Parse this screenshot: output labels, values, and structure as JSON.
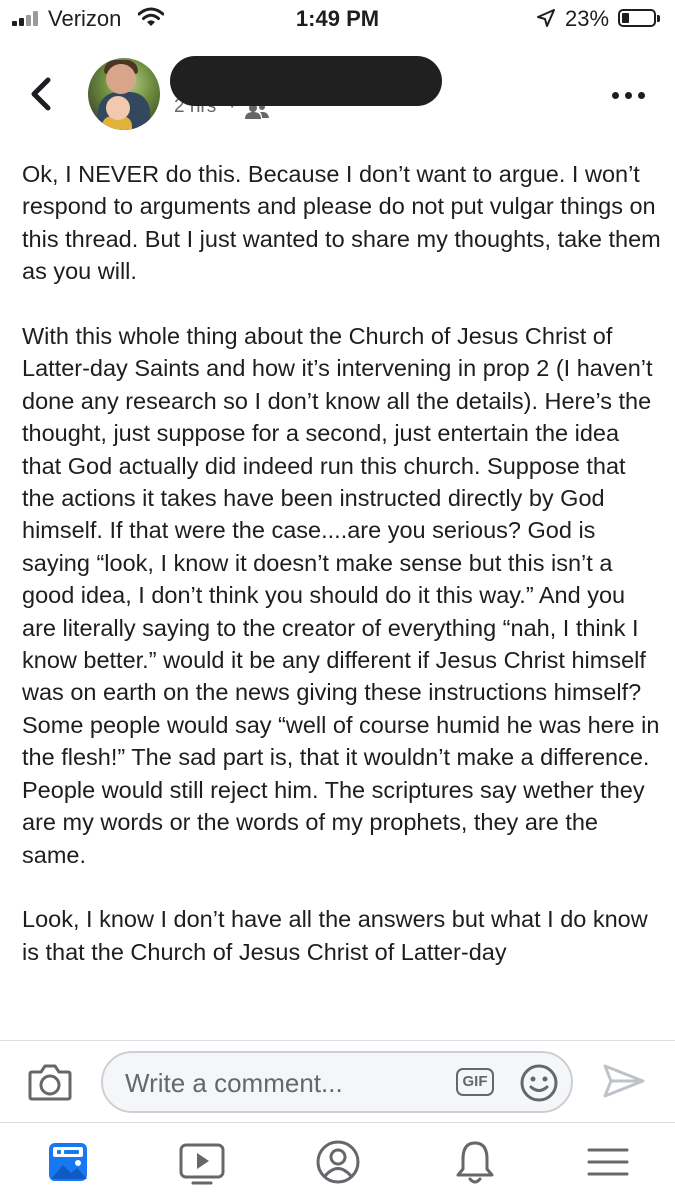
{
  "status_bar": {
    "carrier": "Verizon",
    "time": "1:49 PM",
    "battery_percent": "23%",
    "battery_level": 0.23
  },
  "post": {
    "time": "2 hrs",
    "separator": "·",
    "audience_icon": "friends-icon",
    "paragraphs": [
      "Ok, I NEVER do this. Because I don’t want to argue. I won’t respond to arguments and please do not put vulgar things on this thread. But I just wanted to share my thoughts, take them as you will.",
      "With this whole thing about the Church of Jesus Christ of Latter-day Saints and how it’s intervening in prop 2 (I haven’t done any research so I don’t know all the details). Here’s the thought, just suppose for a second, just entertain the idea that God actually did indeed run this church. Suppose that the actions it takes have been instructed directly by God himself. If that were the case....are you serious? God is saying “look, I know it doesn’t make sense but this isn’t a good idea, I don’t think you should do it this way.” And you are literally saying to the creator of everything “nah, I think I know better.” would it be any different if Jesus Christ himself was on earth on the news giving these instructions himself? Some people would say “well of course humid he was here in the flesh!” The sad part is, that it wouldn’t make a difference. People would still reject him. The scriptures say wether they are my words or the words of my prophets, they are the same.",
      "Look, I know I don’t have all the answers but what I do know is that the Church of Jesus Christ of Latter-day"
    ]
  },
  "comment_bar": {
    "placeholder": "Write a comment...",
    "gif_label": "GIF"
  },
  "tab_bar": {
    "tabs": [
      {
        "icon": "news-feed-icon",
        "active": true
      },
      {
        "icon": "watch-icon",
        "active": false
      },
      {
        "icon": "profile-icon",
        "active": false
      },
      {
        "icon": "notifications-icon",
        "active": false
      },
      {
        "icon": "menu-icon",
        "active": false
      }
    ]
  },
  "colors": {
    "active_tab": "#1877f2",
    "inactive_icon": "#65676b",
    "text": "#1c1e21"
  }
}
